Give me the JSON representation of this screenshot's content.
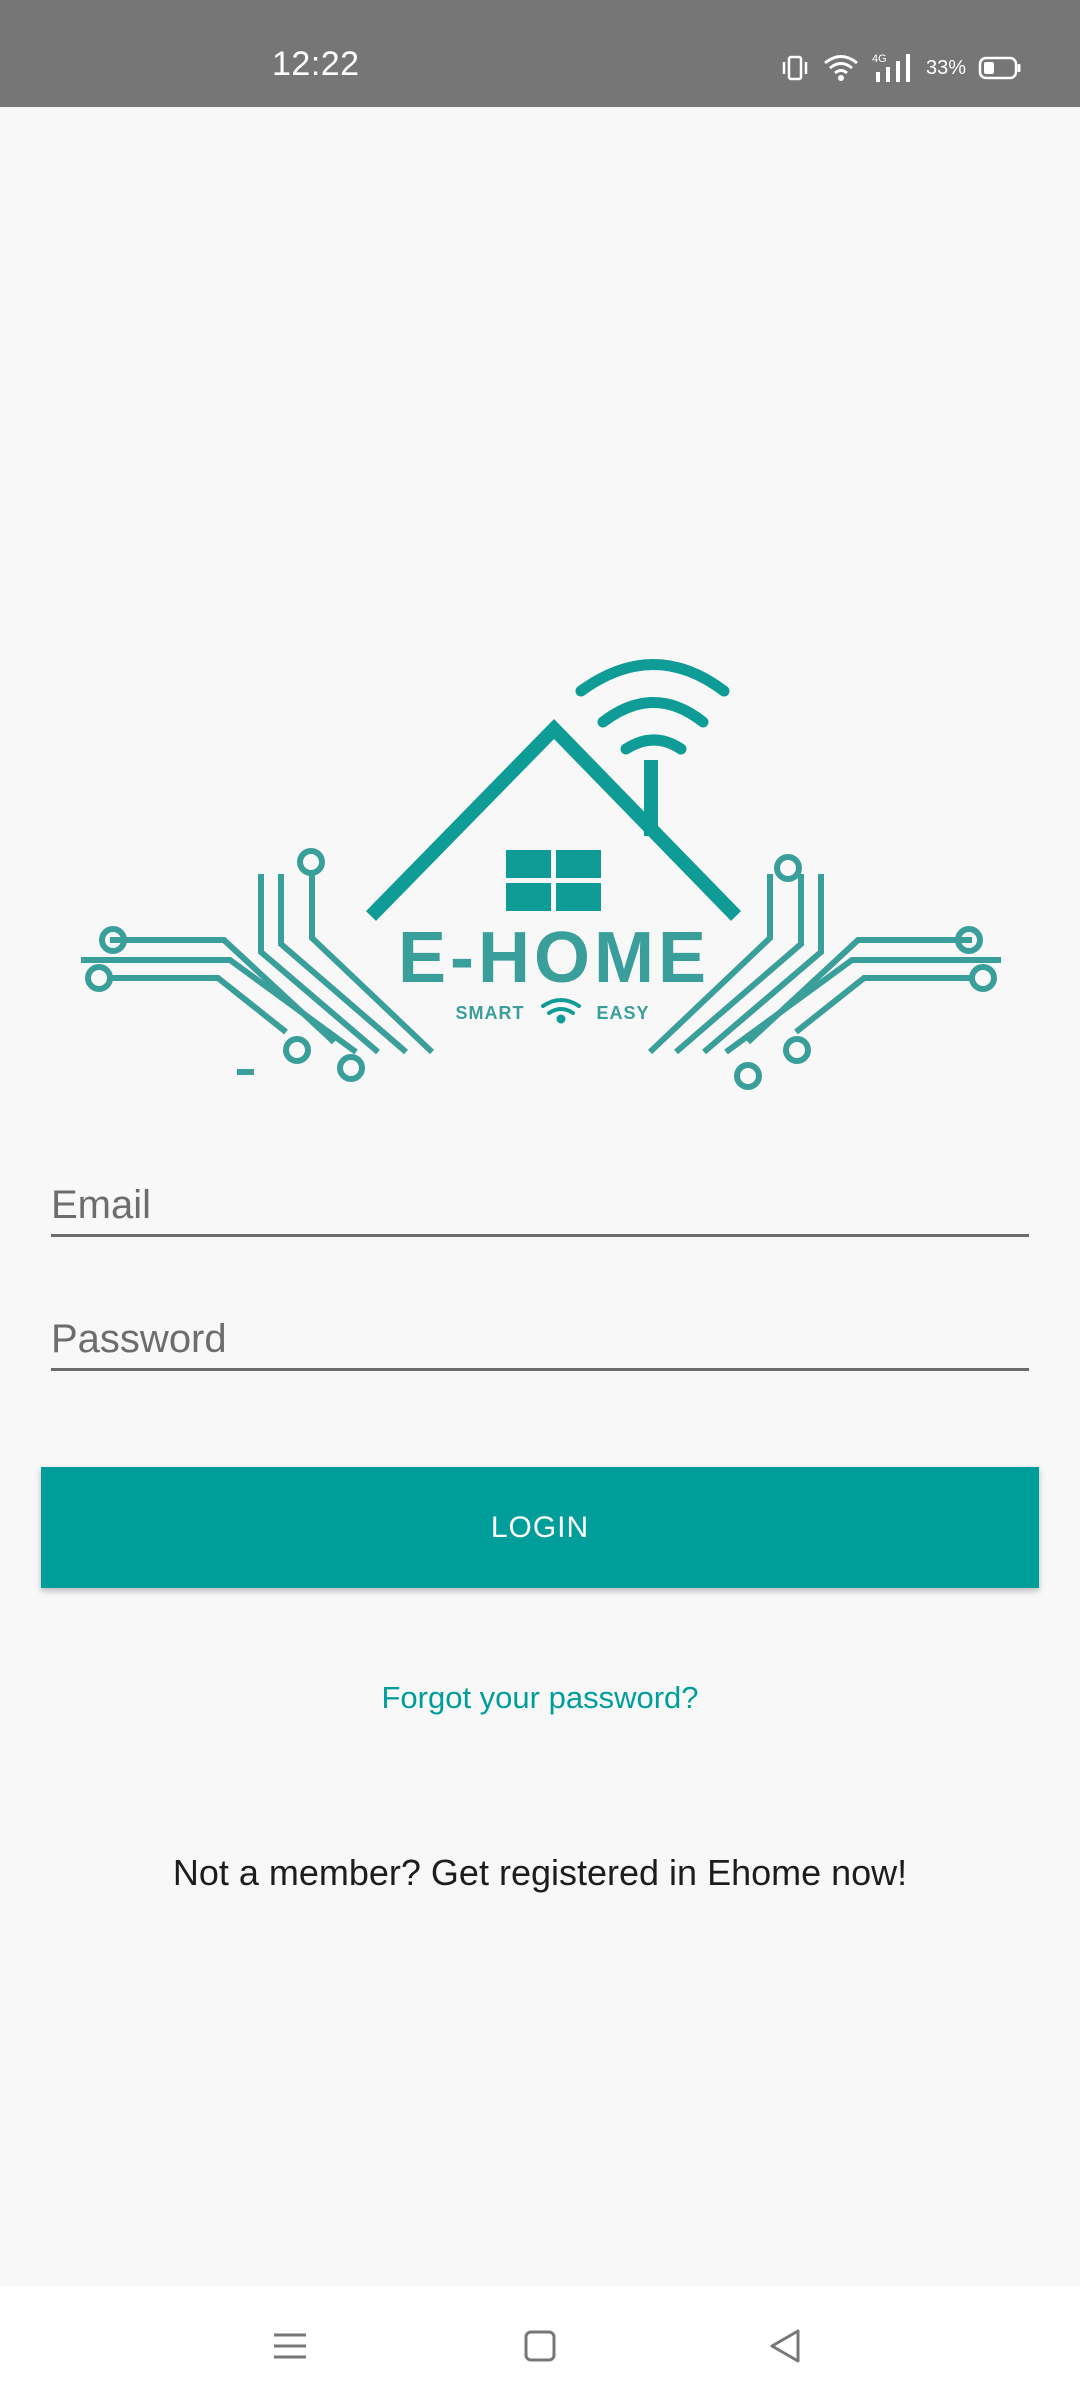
{
  "status_bar": {
    "time": "12:22",
    "network": "4G",
    "battery": "33%"
  },
  "logo": {
    "brand": "E-HOME",
    "tag_left": "SMART",
    "tag_right": "EASY"
  },
  "form": {
    "email_placeholder": "Email",
    "password_placeholder": "Password",
    "login_label": "LOGIN",
    "forgot_label": "Forgot your password?",
    "register_label": "Not a member? Get registered in Ehome now!"
  },
  "colors": {
    "accent": "#009e9b",
    "status_bar": "#767676",
    "background": "#f8f8f8"
  },
  "icons": {
    "vibrate": "vibrate-icon",
    "wifi": "wifi-icon",
    "signal": "signal-icon",
    "battery": "battery-icon",
    "nav_menu": "menu-icon",
    "nav_home": "home-square-icon",
    "nav_back": "back-triangle-icon"
  }
}
